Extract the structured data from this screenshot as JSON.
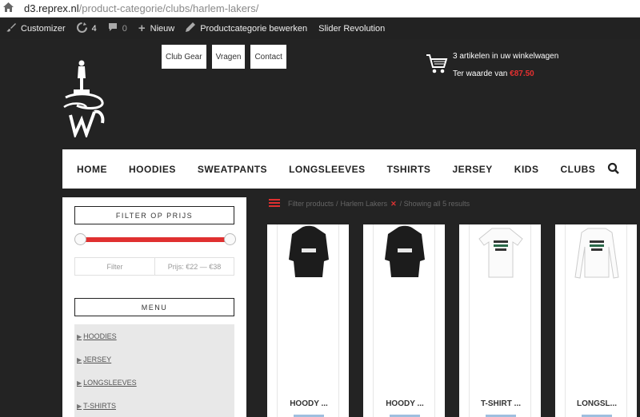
{
  "browser": {
    "host": "d3.reprex.nl",
    "path": "/product-categorie/clubs/harlem-lakers/"
  },
  "adminbar": {
    "customizer": "Customizer",
    "updates": "4",
    "comments": "0",
    "new": "Nieuw",
    "edit": "Productcategorie bewerken",
    "slider": "Slider Revolution"
  },
  "topnav": [
    "Club Gear",
    "Vragen",
    "Contact"
  ],
  "cart": {
    "line1": "3 artikelen in uw winkelwagen",
    "line2_prefix": "Ter waarde van",
    "price": "€87.50"
  },
  "mainnav": [
    "HOME",
    "HOODIES",
    "SWEATPANTS",
    "LONGSLEEVES",
    "TSHIRTS",
    "JERSEY",
    "KIDS",
    "CLUBS"
  ],
  "sidebar": {
    "filter_title": "FILTER OP PRIJS",
    "filter_button": "Filter",
    "price_range": "Prijs: €22 — €38",
    "menu_title": "MENU",
    "menu_items": [
      "HOODIES",
      "JERSEY",
      "LONGSLEEVES",
      "T-SHIRTS"
    ]
  },
  "breadcrumb": {
    "filter": "Filter products",
    "sep": "/",
    "category": "Harlem Lakers",
    "results": "/ Showing all 5 results"
  },
  "products": [
    {
      "title": "HOODY ...",
      "kind": "hoodie"
    },
    {
      "title": "HOODY ...",
      "kind": "hoodie"
    },
    {
      "title": "T-SHIRT ...",
      "kind": "tshirt"
    },
    {
      "title": "LONGSL...",
      "kind": "longsleeve"
    }
  ],
  "colors": {
    "accent": "#e03030",
    "bg": "#232323"
  }
}
